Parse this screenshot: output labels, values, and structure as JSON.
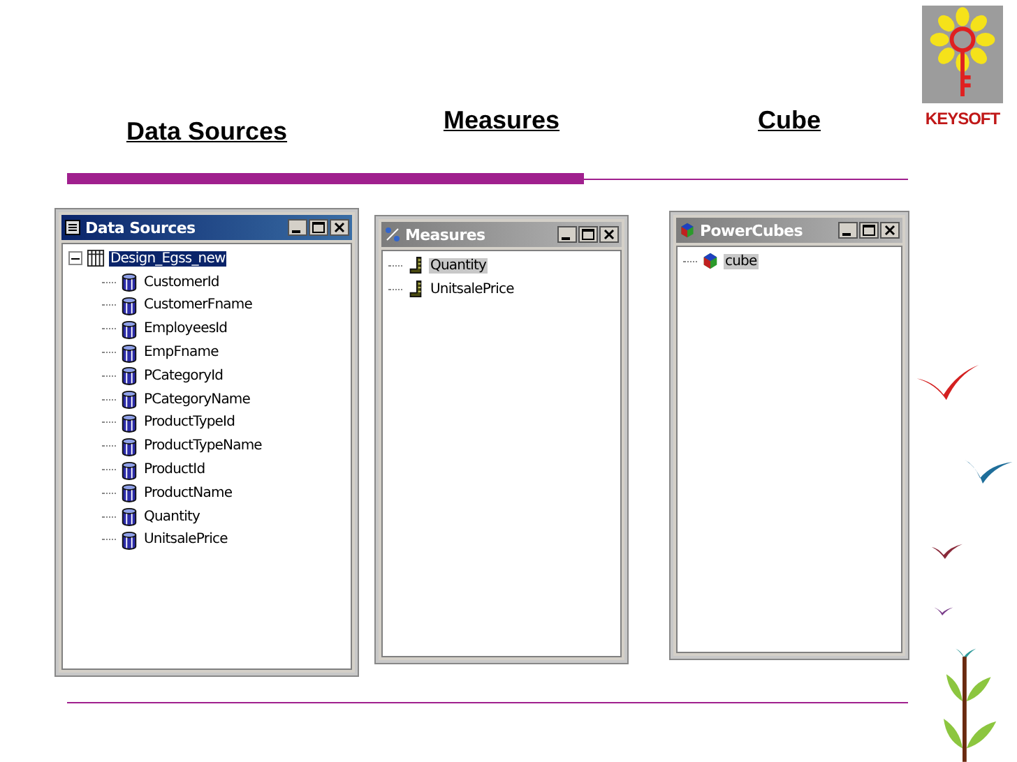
{
  "headings": [
    {
      "label": "Data Sources"
    },
    {
      "label": "Measures"
    },
    {
      "label": "Cube"
    }
  ],
  "logo": {
    "text": "KEYSOFT"
  },
  "windows": [
    {
      "title": "Data Sources",
      "active": true,
      "kind": "sources",
      "items": [
        {
          "label": "Design_Egss_new",
          "kind": "table",
          "selected": true,
          "expanded": true,
          "children": [
            {
              "label": "CustomerId",
              "kind": "column",
              "selected": false
            },
            {
              "label": "CustomerFname",
              "kind": "column",
              "selected": false
            },
            {
              "label": "EmployeesId",
              "kind": "column",
              "selected": false
            },
            {
              "label": "EmpFname",
              "kind": "column",
              "selected": false
            },
            {
              "label": "PCategoryId",
              "kind": "column",
              "selected": false
            },
            {
              "label": "PCategoryName",
              "kind": "column",
              "selected": false
            },
            {
              "label": "ProductTypeId",
              "kind": "column",
              "selected": false
            },
            {
              "label": "ProductTypeName",
              "kind": "column",
              "selected": false
            },
            {
              "label": "ProductId",
              "kind": "column",
              "selected": false
            },
            {
              "label": "ProductName",
              "kind": "column",
              "selected": false
            },
            {
              "label": "Quantity",
              "kind": "column",
              "selected": false
            },
            {
              "label": "UnitsalePrice",
              "kind": "column",
              "selected": false
            }
          ]
        }
      ]
    },
    {
      "title": "Measures",
      "active": false,
      "kind": "measures",
      "items": [
        {
          "label": "Quantity",
          "kind": "measure",
          "selected": true
        },
        {
          "label": "UnitsalePrice",
          "kind": "measure",
          "selected": false
        }
      ]
    },
    {
      "title": "PowerCubes",
      "active": false,
      "kind": "cubes",
      "items": [
        {
          "label": "cube",
          "kind": "cube",
          "selected": true
        }
      ]
    }
  ]
}
